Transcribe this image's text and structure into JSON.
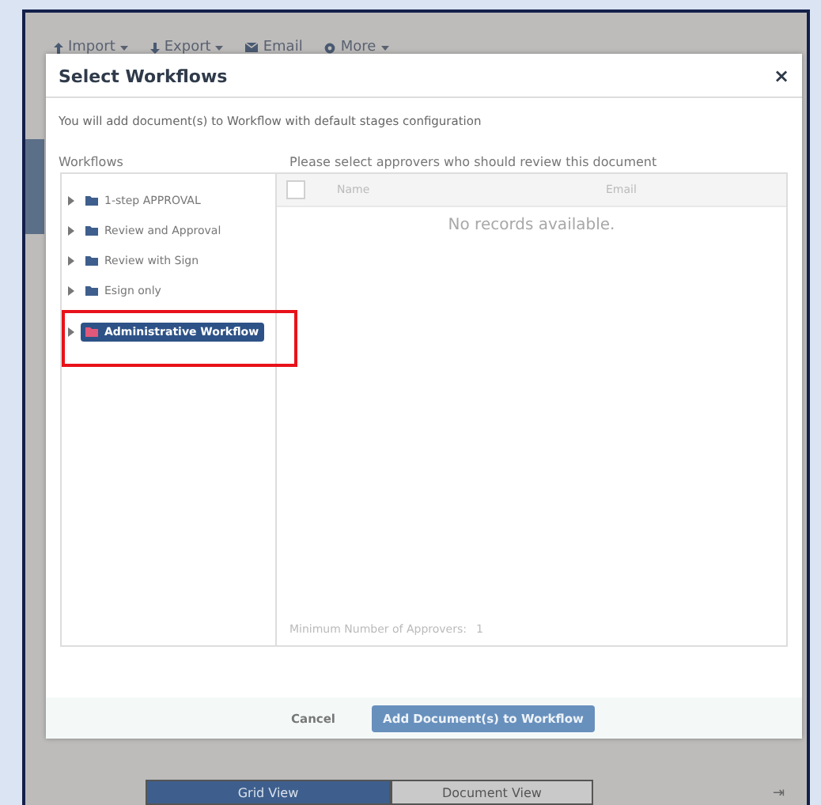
{
  "toolbar": [
    {
      "label": "Import",
      "kind": "up",
      "dropdown": true
    },
    {
      "label": "Export",
      "kind": "down",
      "dropdown": true
    },
    {
      "label": "Email",
      "kind": "mail",
      "dropdown": false
    },
    {
      "label": "More",
      "kind": "gear",
      "dropdown": true
    }
  ],
  "dialog": {
    "title": "Select Workflows",
    "close": "×",
    "intro": "You will add document(s) to Workflow with default stages configuration",
    "workflows_label": "Workflows",
    "workflows": [
      {
        "label": "1-step APPROVAL",
        "selected": false,
        "highlighted": false
      },
      {
        "label": "Review and Approval",
        "selected": false,
        "highlighted": false
      },
      {
        "label": "Review with Sign",
        "selected": false,
        "highlighted": false
      },
      {
        "label": "Esign only",
        "selected": false,
        "highlighted": false
      },
      {
        "label": "Administrative Workflow",
        "selected": true,
        "highlighted": true
      }
    ],
    "approvers_label": "Please select approvers who should review this document",
    "select_all": {
      "checked": false
    },
    "columns": [
      "Name",
      "Email"
    ],
    "empty": "No records available.",
    "min_label": "Minimum Number of Approvers:",
    "min_value": "1",
    "buttons": [
      {
        "label": "Cancel",
        "kind": "plain"
      },
      {
        "label": "Add Document(s) to Workflow",
        "kind": "primary"
      }
    ]
  },
  "view_tabs": [
    {
      "label": "Grid View",
      "selected": true
    },
    {
      "label": "Document View",
      "selected": false
    }
  ],
  "collapse": "⇥"
}
